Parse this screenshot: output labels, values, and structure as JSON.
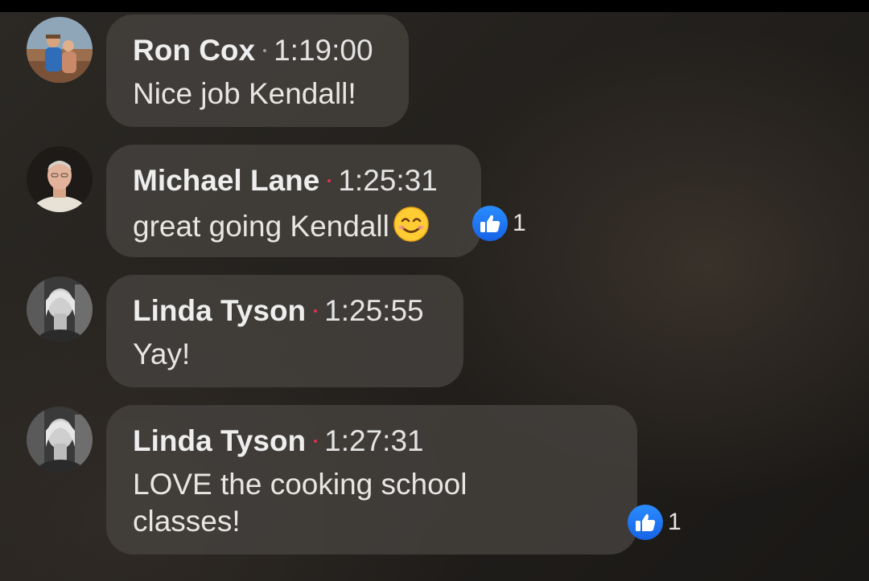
{
  "comments": [
    {
      "author": "Ron Cox",
      "time": "1:19:00",
      "text": "Nice job Kendall!",
      "avatar_icon": "user-avatar-photo"
    },
    {
      "author": "Michael Lane",
      "time": "1:25:31",
      "text": "great going Kendall",
      "emoji": "smiling-face-emoji",
      "reaction": {
        "icon": "like-icon",
        "count": "1"
      }
    },
    {
      "author": "Linda Tyson",
      "time": "1:25:55",
      "text": "Yay!"
    },
    {
      "author": "Linda Tyson",
      "time": "1:27:31",
      "text": "LOVE the cooking school\nclasses!",
      "reaction": {
        "icon": "like-icon",
        "count": "1"
      }
    }
  ],
  "colors": {
    "bubble": "#46423e",
    "like_blue": "#1b74f0",
    "new_dot": "#e0324a"
  }
}
